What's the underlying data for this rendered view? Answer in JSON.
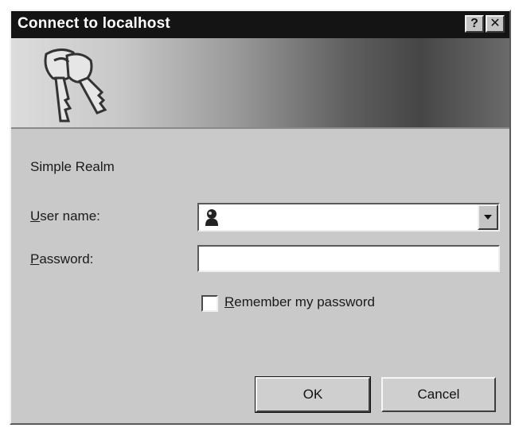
{
  "window": {
    "title": "Connect to localhost",
    "help_glyph": "?",
    "close_glyph": "✕"
  },
  "dialog": {
    "realm": "Simple Realm",
    "username_label_mnemonic": "U",
    "username_label_rest": "ser name:",
    "username_value": "",
    "password_label_mnemonic": "P",
    "password_label_rest": "assword:",
    "password_value": "",
    "remember_label_mnemonic": "R",
    "remember_label_rest": "emember my password",
    "remember_checked": false
  },
  "buttons": {
    "ok_label": "OK",
    "cancel_label": "Cancel"
  },
  "icons": {
    "banner": "keys-icon",
    "user": "user-icon",
    "dropdown": "chevron-down-icon"
  }
}
